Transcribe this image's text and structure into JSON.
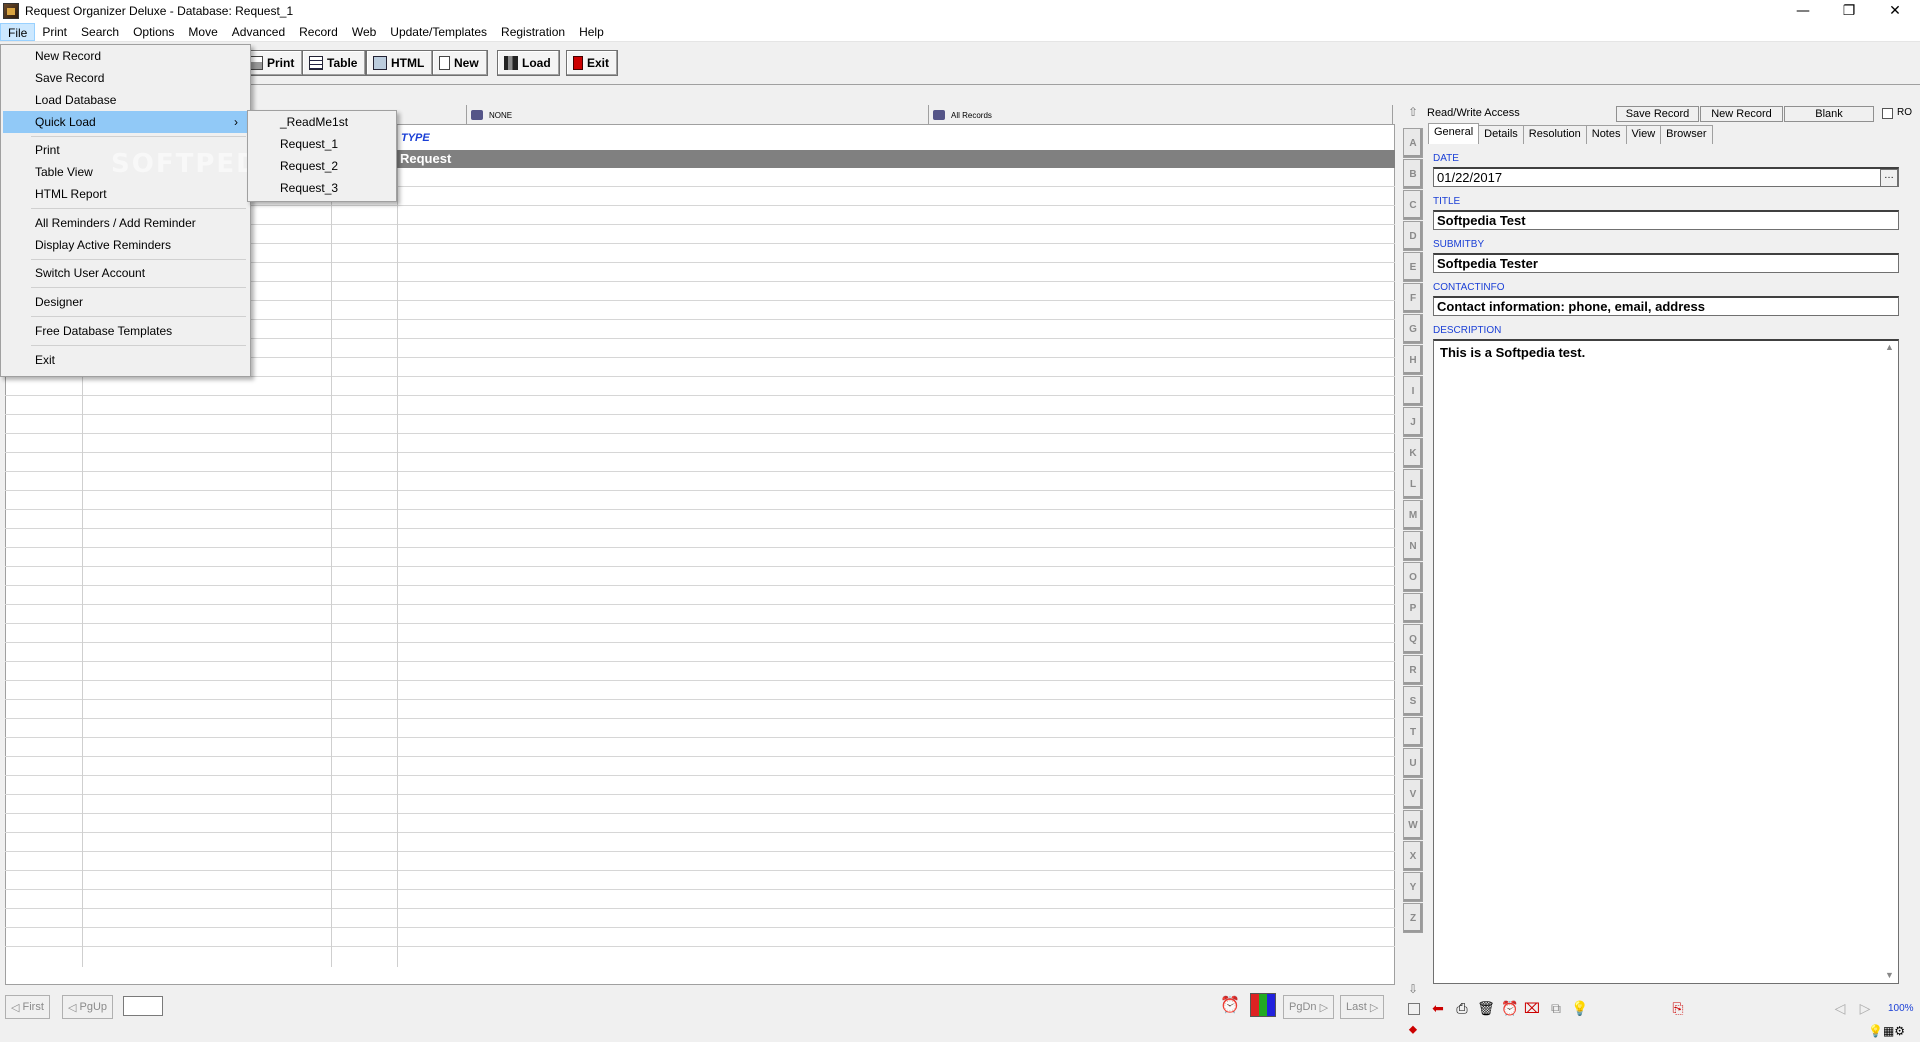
{
  "window": {
    "title": "Request Organizer Deluxe - Database: Request_1",
    "minimize": "—",
    "restore": "❐",
    "close": "✕"
  },
  "menubar": [
    "File",
    "Print",
    "Search",
    "Options",
    "Move",
    "Advanced",
    "Record",
    "Web",
    "Update/Templates",
    "Registration",
    "Help"
  ],
  "toolbar": {
    "print": "Print",
    "table": "Table",
    "html": "HTML",
    "new": "New",
    "load": "Load",
    "exit": "Exit"
  },
  "filter": {
    "group": "NONE",
    "records": "All Records"
  },
  "list": {
    "column_header": "TYPE",
    "selected_row": "Request"
  },
  "file_menu": {
    "items": {
      "new_record": "New Record",
      "save_record": "Save Record",
      "load_database": "Load Database",
      "quick_load": "Quick Load",
      "print": "Print",
      "table_view": "Table View",
      "html_report": "HTML Report",
      "all_reminders": "All Reminders / Add Reminder",
      "display_reminders": "Display Active Reminders",
      "switch_user": "Switch User Account",
      "designer": "Designer",
      "free_templates": "Free Database Templates",
      "exit": "Exit"
    },
    "watermark": "SOFTPEDIA",
    "quick_load_items": [
      "_ReadMe1st",
      "Request_1",
      "Request_2",
      "Request_3"
    ]
  },
  "nav": {
    "first": "First",
    "pgup": "PgUp",
    "pgdn": "PgDn",
    "last": "Last"
  },
  "alphabet": [
    "A",
    "B",
    "C",
    "D",
    "E",
    "F",
    "G",
    "H",
    "I",
    "J",
    "K",
    "L",
    "M",
    "N",
    "O",
    "P",
    "Q",
    "R",
    "S",
    "T",
    "U",
    "V",
    "W",
    "X",
    "Y",
    "Z"
  ],
  "record_panel": {
    "access": "Read/Write Access",
    "save_record": "Save Record",
    "new_record": "New Record",
    "blank": "Blank",
    "ro": "RO",
    "tabs": [
      "General",
      "Details",
      "Resolution",
      "Notes",
      "View",
      "Browser"
    ],
    "fields": {
      "date_label": "DATE",
      "date_value": "01/22/2017",
      "title_label": "TITLE",
      "title_value": "Softpedia Test",
      "submitby_label": "SUBMITBY",
      "submitby_value": "Softpedia Tester",
      "contactinfo_label": "CONTACTINFO",
      "contactinfo_value": "Contact information: phone, email, address",
      "description_label": "DESCRIPTION",
      "description_value": "This is a Softpedia test."
    },
    "zoom": "100%"
  }
}
